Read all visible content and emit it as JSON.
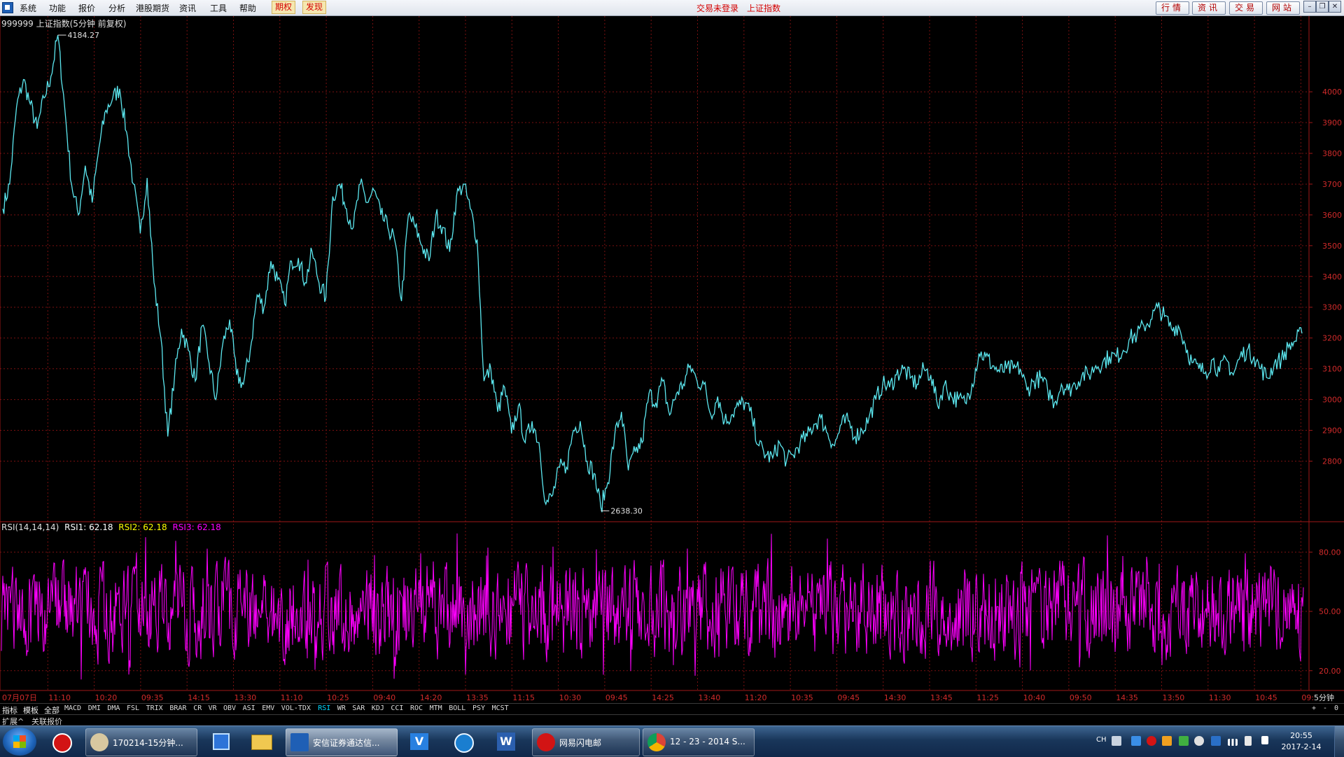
{
  "menubar": {
    "items": [
      "系统",
      "功能",
      "报价",
      "分析",
      "港股期货",
      "资讯",
      "工具",
      "帮助"
    ],
    "tab_options": "期权",
    "tab_discover": "发现",
    "status_msg": "交易未登录　上证指数",
    "right_buttons": [
      "行情",
      "资讯",
      "交易",
      "网站"
    ]
  },
  "chart": {
    "header": "999999 上证指数(5分钟 前复权)",
    "high_label": "4184.27",
    "low_label": "2638.30",
    "price_ticks": [
      "4000",
      "3900",
      "3800",
      "3700",
      "3600",
      "3500",
      "3400",
      "3300",
      "3200",
      "3100",
      "3000",
      "2900",
      "2800"
    ],
    "time_labels": [
      "07月07日",
      "11:10",
      "10:20",
      "09:35",
      "14:15",
      "13:30",
      "11:10",
      "10:25",
      "09:40",
      "14:20",
      "13:35",
      "11:15",
      "10:30",
      "09:45",
      "14:25",
      "13:40",
      "11:20",
      "10:35",
      "09:45",
      "14:30",
      "13:45",
      "11:25",
      "10:40",
      "09:50",
      "14:35",
      "13:50",
      "11:30",
      "10:45",
      "09:"
    ],
    "period_label": "5分钟",
    "colors": {
      "price_line": "#5ce8f0",
      "grid": "#7a1010",
      "axis": "#a01818",
      "label": "#d02a2a",
      "rsi": "#ff00ff"
    }
  },
  "chart_data": [
    {
      "type": "line",
      "title": "999999 上证指数(5分钟 前复权)",
      "y_ticks": [
        4000,
        3900,
        3800,
        3700,
        3600,
        3500,
        3400,
        3300,
        3200,
        3100,
        3000,
        2900,
        2800
      ],
      "ylim": [
        2610,
        4230
      ],
      "x_tick_labels": [
        "07月07日",
        "11:10",
        "10:20",
        "09:35",
        "14:15",
        "13:30",
        "11:10",
        "10:25",
        "09:40",
        "14:20",
        "13:35",
        "11:15",
        "10:30",
        "09:45",
        "14:25",
        "13:40",
        "11:20",
        "10:35",
        "09:45",
        "14:30",
        "13:45",
        "11:25",
        "10:40",
        "09:50",
        "14:35",
        "13:50",
        "11:30",
        "10:45",
        "09:"
      ],
      "annotations": {
        "high": 4184.27,
        "low": 2638.3
      },
      "series": [
        {
          "values": [
            3620,
            3700,
            3950,
            4040,
            3960,
            3880,
            3980,
            4050,
            4184,
            3950,
            3700,
            3600,
            3760,
            3640,
            3820,
            3940,
            3980,
            4010,
            3870,
            3700,
            3540,
            3720,
            3380,
            3200,
            2880,
            3080,
            3230,
            3160,
            3060,
            3240,
            3120,
            3000,
            3180,
            3260,
            3080,
            3050,
            3160,
            3340,
            3300,
            3450,
            3390,
            3310,
            3450,
            3460,
            3380,
            3480,
            3380,
            3330,
            3660,
            3700,
            3620,
            3560,
            3700,
            3640,
            3680,
            3600,
            3560,
            3520,
            3320,
            3600,
            3560,
            3500,
            3450,
            3600,
            3560,
            3480,
            3660,
            3700,
            3620,
            3520,
            3060,
            3100,
            2960,
            3040,
            2890,
            2980,
            2860,
            2930,
            2860,
            2660,
            2690,
            2780,
            2780,
            2900,
            2930,
            2800,
            2760,
            2650,
            2730,
            2880,
            2960,
            2770,
            2830,
            2860,
            3020,
            2990,
            3060,
            2950,
            3020,
            3050,
            3110,
            3060,
            3050,
            2950,
            3010,
            2930,
            2950,
            2980,
            2990,
            2940,
            2850,
            2820,
            2810,
            2860,
            2800,
            2820,
            2860,
            2880,
            2920,
            2940,
            2890,
            2850,
            2920,
            2930,
            2880,
            2900,
            2940,
            3000,
            3050,
            3040,
            3080,
            3100,
            3070,
            3050,
            3100,
            3080,
            2980,
            3050,
            3010,
            3000,
            2990,
            3050,
            3150,
            3140,
            3110,
            3090,
            3100,
            3100,
            3100,
            3030,
            3060,
            3070,
            3030,
            2990,
            3050,
            3030,
            3050,
            3080,
            3080,
            3110,
            3120,
            3140,
            3140,
            3160,
            3200,
            3210,
            3240,
            3260,
            3300,
            3270,
            3230,
            3240,
            3180,
            3120,
            3100,
            3090,
            3130,
            3090,
            3130,
            3080,
            3140,
            3160,
            3140,
            3100,
            3070,
            3120,
            3130,
            3170,
            3190,
            3215
          ]
        }
      ]
    },
    {
      "type": "line",
      "title": "RSI(14,14,14)",
      "series_labels": [
        "RSI1: 62.18",
        "RSI2: 62.18",
        "RSI3: 62.18"
      ],
      "y_ticks": [
        20,
        50,
        80
      ],
      "ylim": [
        10,
        95
      ],
      "last_value": 62.18
    }
  ],
  "rsi": {
    "label": "RSI(14,14,14)",
    "rsi1": "RSI1: 62.18",
    "rsi2": "RSI2: 62.18",
    "rsi3": "RSI3: 62.18",
    "ticks": [
      "80.00",
      "50.00",
      "20.00"
    ]
  },
  "indicator_bar": {
    "tabs": [
      "指标",
      "模板",
      "全部"
    ],
    "items": [
      "MACD",
      "DMI",
      "DMA",
      "FSL",
      "TRIX",
      "BRAR",
      "CR",
      "VR",
      "OBV",
      "ASI",
      "EMV",
      "VOL-TDX",
      "RSI",
      "WR",
      "SAR",
      "KDJ",
      "CCI",
      "ROC",
      "MTM",
      "BOLL",
      "PSY",
      "MCST"
    ],
    "active": "RSI",
    "right_controls": [
      "+",
      "-",
      "0"
    ]
  },
  "status_line": {
    "expand": "扩展^",
    "related": "关联报价"
  },
  "taskbar": {
    "tasks": [
      {
        "label": "170214-15分钟..."
      },
      {
        "label": "安信证券通达信..."
      },
      {
        "label": "网易闪电邮"
      },
      {
        "label": "12 - 23 - 2014 S..."
      }
    ],
    "lang": "CH",
    "time": "20:55",
    "date": "2017-2-14"
  }
}
